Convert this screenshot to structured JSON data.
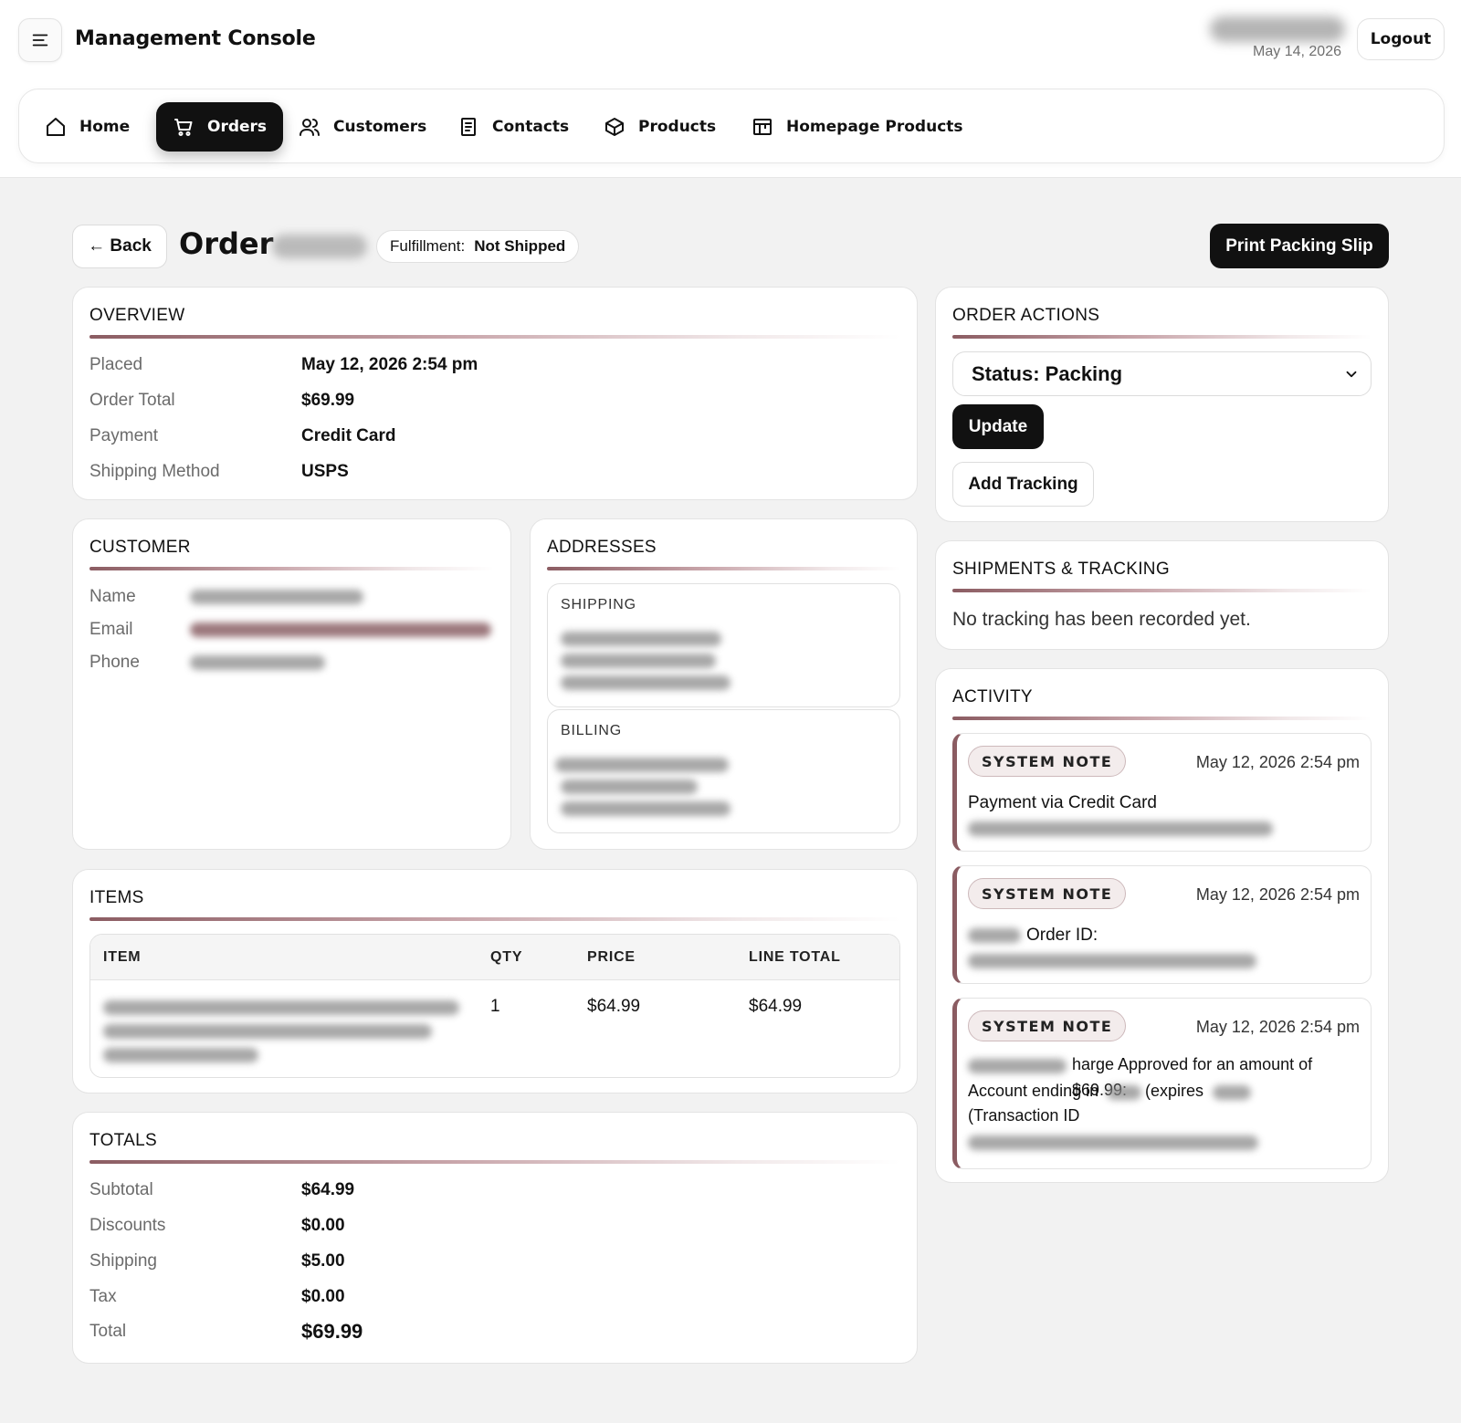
{
  "header": {
    "brand": "Management Console",
    "date": "May 14, 2026",
    "logout_label": "Logout"
  },
  "nav": {
    "items": [
      {
        "label": "Home",
        "icon": "home-icon"
      },
      {
        "label": "Orders",
        "icon": "cart-icon",
        "active": true
      },
      {
        "label": "Customers",
        "icon": "users-icon"
      },
      {
        "label": "Contacts",
        "icon": "document-icon"
      },
      {
        "label": "Products",
        "icon": "box-icon"
      },
      {
        "label": "Homepage Products",
        "icon": "storefront-icon"
      }
    ]
  },
  "page": {
    "back_label": "← Back",
    "order_prefix": "Order",
    "fulfillment_label": "Fulfillment:",
    "fulfillment_value": "Not Shipped",
    "print_label": "Print Packing Slip"
  },
  "overview": {
    "title": "OVERVIEW",
    "rows": [
      {
        "label": "Placed",
        "value": "May 12, 2026 2:54 pm"
      },
      {
        "label": "Order Total",
        "value": "$69.99"
      },
      {
        "label": "Payment",
        "value": "Credit Card"
      },
      {
        "label": "Shipping Method",
        "value": "USPS"
      }
    ]
  },
  "customer": {
    "title": "CUSTOMER",
    "labels": [
      "Name",
      "Email",
      "Phone"
    ]
  },
  "addresses": {
    "title": "ADDRESSES",
    "shipping_label": "SHIPPING",
    "billing_label": "BILLING"
  },
  "items": {
    "title": "ITEMS",
    "columns": [
      "ITEM",
      "QTY",
      "PRICE",
      "LINE TOTAL"
    ],
    "rows": [
      {
        "qty": "1",
        "price": "$64.99",
        "line_total": "$64.99"
      }
    ]
  },
  "totals": {
    "title": "TOTALS",
    "rows": [
      {
        "label": "Subtotal",
        "value": "$64.99"
      },
      {
        "label": "Discounts",
        "value": "$0.00"
      },
      {
        "label": "Shipping",
        "value": "$5.00"
      },
      {
        "label": "Tax",
        "value": "$0.00"
      },
      {
        "label": "Total",
        "value": "$69.99"
      }
    ]
  },
  "order_actions": {
    "title": "ORDER ACTIONS",
    "status_selected": "Status: Packing",
    "update_label": "Update",
    "add_tracking_label": "Add Tracking"
  },
  "shipments": {
    "title": "SHIPMENTS & TRACKING",
    "empty_text": "No tracking has been recorded yet."
  },
  "activity": {
    "title": "ACTIVITY",
    "notes": [
      {
        "badge": "SYSTEM NOTE",
        "time": "May 12, 2026 2:54 pm",
        "text": "Payment via Credit Card"
      },
      {
        "badge": "SYSTEM NOTE",
        "time": "May 12, 2026 2:54 pm",
        "text": "Order ID:"
      },
      {
        "badge": "SYSTEM NOTE",
        "time": "May 12, 2026 2:54 pm",
        "text_a": "harge Approved for an amount of $69.99:",
        "text_b": "Account ending in",
        "text_c": "(expires",
        "text_d": "(Transaction ID"
      }
    ]
  },
  "colors": {
    "accent_rule": "#8b5c62",
    "primary_button": "#111111",
    "background": "#f2f2f2"
  }
}
